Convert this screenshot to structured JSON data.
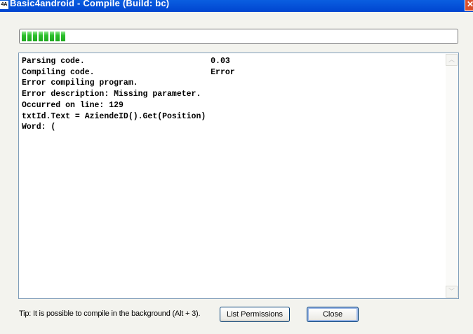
{
  "window": {
    "title": "Basic4android - Compile (Build: bc)",
    "app_icon": "4A"
  },
  "progress": {
    "percent": 10,
    "segments": 8
  },
  "output": {
    "lines": [
      "Parsing code.                          0.03",
      "Compiling code.                        Error",
      "Error compiling program.",
      "Error description: Missing parameter.",
      "Occurred on line: 129",
      "txtId.Text = AziendeID().Get(Position)",
      "Word: ("
    ]
  },
  "footer": {
    "tip": "Tip: It is possible to compile in the background (Alt + 3).",
    "list_permissions_label": "List Permissions",
    "close_label": "Close"
  }
}
